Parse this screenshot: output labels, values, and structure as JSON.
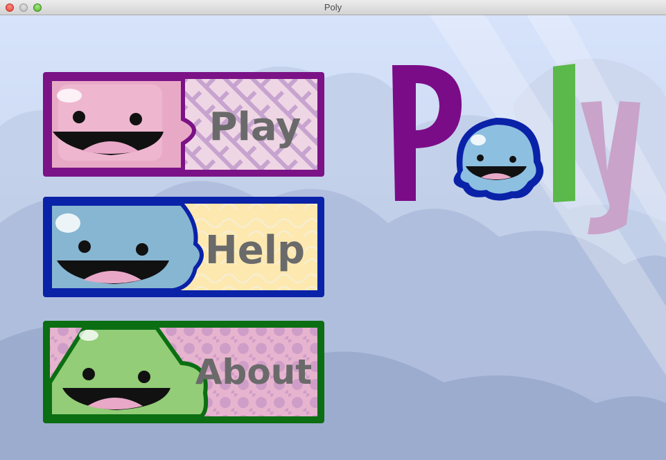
{
  "window": {
    "title": "Poly"
  },
  "menu": {
    "buttons": [
      {
        "id": "play",
        "label": "Play",
        "character": "pink-square-character",
        "frame": "#7b1286",
        "face": "#e8a9c6",
        "pattern": "#e8c2d8"
      },
      {
        "id": "help",
        "label": "Help",
        "character": "blue-blob-character",
        "frame": "#0a22a8",
        "face": "#87b6d2",
        "pattern": "#fbe7a8"
      },
      {
        "id": "about",
        "label": "About",
        "character": "green-triangle-character",
        "frame": "#0b6e12",
        "face": "#93cd77",
        "pattern": "#e6b1cc"
      }
    ]
  },
  "logo": {
    "text": "Poly",
    "colors": {
      "p": "#7b0c88",
      "o": "#8dbfe0",
      "l": "#5bb84a",
      "y": "#c9a3c9"
    }
  }
}
